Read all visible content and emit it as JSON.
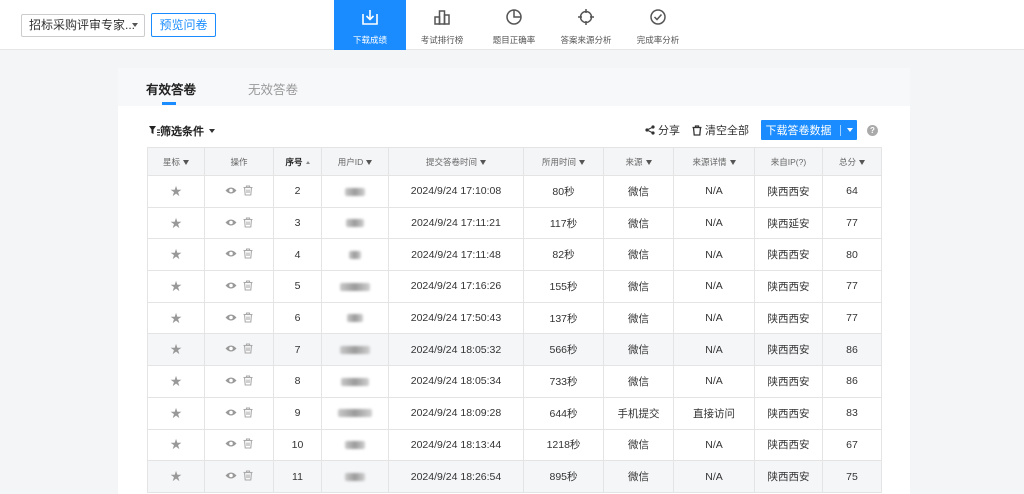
{
  "header": {
    "survey_select": "招标采购评审专家...",
    "preview_button": "预览问卷",
    "nav": [
      {
        "label": "下载成绩",
        "icon": "download-icon",
        "active": true
      },
      {
        "label": "考试排行榜",
        "icon": "ranking-icon",
        "active": false
      },
      {
        "label": "题目正确率",
        "icon": "pie-chart-icon",
        "active": false
      },
      {
        "label": "答案来源分析",
        "icon": "crosshair-icon",
        "active": false
      },
      {
        "label": "完成率分析",
        "icon": "check-circle-icon",
        "active": false
      }
    ]
  },
  "tabs": {
    "valid": "有效答卷",
    "invalid": "无效答卷"
  },
  "toolbar": {
    "filter": "筛选条件",
    "share": "分享",
    "clear_all": "清空全部",
    "download": "下载答卷数据",
    "help": "?"
  },
  "table": {
    "columns": [
      "星标",
      "操作",
      "序号",
      "用户ID",
      "提交答卷时间",
      "所用时间",
      "来源",
      "来源详情",
      "来自IP(?)",
      "总分"
    ],
    "rows": [
      {
        "seq": "2",
        "time": "2024/9/24 17:10:08",
        "duration": "80秒",
        "source": "微信",
        "detail": "N/A",
        "ip": "陕西西安",
        "score": "64"
      },
      {
        "seq": "3",
        "time": "2024/9/24 17:11:21",
        "duration": "117秒",
        "source": "微信",
        "detail": "N/A",
        "ip": "陕西延安",
        "score": "77"
      },
      {
        "seq": "4",
        "time": "2024/9/24 17:11:48",
        "duration": "82秒",
        "source": "微信",
        "detail": "N/A",
        "ip": "陕西西安",
        "score": "80"
      },
      {
        "seq": "5",
        "time": "2024/9/24 17:16:26",
        "duration": "155秒",
        "source": "微信",
        "detail": "N/A",
        "ip": "陕西西安",
        "score": "77"
      },
      {
        "seq": "6",
        "time": "2024/9/24 17:50:43",
        "duration": "137秒",
        "source": "微信",
        "detail": "N/A",
        "ip": "陕西西安",
        "score": "77"
      },
      {
        "seq": "7",
        "time": "2024/9/24 18:05:32",
        "duration": "566秒",
        "source": "微信",
        "detail": "N/A",
        "ip": "陕西西安",
        "score": "86"
      },
      {
        "seq": "8",
        "time": "2024/9/24 18:05:34",
        "duration": "733秒",
        "source": "微信",
        "detail": "N/A",
        "ip": "陕西西安",
        "score": "86"
      },
      {
        "seq": "9",
        "time": "2024/9/24 18:09:28",
        "duration": "644秒",
        "source": "手机提交",
        "detail": "直接访问",
        "ip": "陕西西安",
        "score": "83"
      },
      {
        "seq": "10",
        "time": "2024/9/24 18:13:44",
        "duration": "1218秒",
        "source": "微信",
        "detail": "N/A",
        "ip": "陕西西安",
        "score": "67"
      },
      {
        "seq": "11",
        "time": "2024/9/24 18:26:54",
        "duration": "895秒",
        "source": "微信",
        "detail": "N/A",
        "ip": "陕西西安",
        "score": "75"
      }
    ]
  },
  "colors": {
    "accent": "#1a8cff",
    "shaded_row": "#f5f6f8"
  }
}
